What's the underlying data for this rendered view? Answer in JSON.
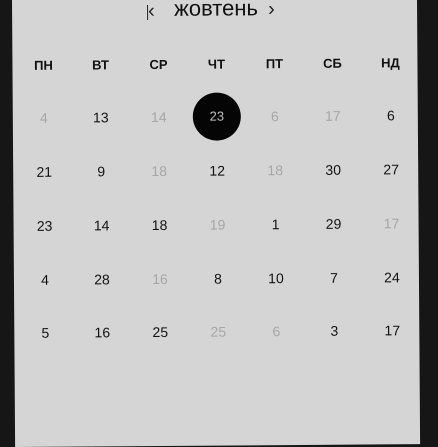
{
  "calendar": {
    "month": "жовтень",
    "prev_icon": "chevron-left-icon",
    "next_icon": "chevron-right-icon",
    "prev_glyph": "‹",
    "next_glyph": "›",
    "weekdays": [
      "ПН",
      "ВТ",
      "СР",
      "ЧТ",
      "ПТ",
      "СБ",
      "НД"
    ],
    "weeks": [
      [
        "4",
        "13",
        "14",
        "23",
        "6",
        "17",
        "6"
      ],
      [
        "21",
        "9",
        "18",
        "12",
        "18",
        "30",
        "27"
      ],
      [
        "23",
        "14",
        "18",
        "19",
        "1",
        "29",
        "17"
      ],
      [
        "4",
        "28",
        "16",
        "8",
        "10",
        "7",
        "24"
      ],
      [
        "5",
        "16",
        "25",
        "25",
        "6",
        "3",
        "17"
      ]
    ],
    "muted": [
      [
        true,
        false,
        true,
        false,
        true,
        true,
        false
      ],
      [
        false,
        false,
        true,
        false,
        true,
        false,
        false
      ],
      [
        false,
        false,
        false,
        true,
        false,
        false,
        true
      ],
      [
        false,
        false,
        true,
        false,
        false,
        false,
        false
      ],
      [
        false,
        false,
        false,
        true,
        true,
        false,
        false
      ]
    ],
    "selected": {
      "week": 0,
      "day": 3
    },
    "colors": {
      "panel": "#d5d5d5",
      "selected_bg": "#050505",
      "muted_text": "#a6a6a6"
    }
  }
}
